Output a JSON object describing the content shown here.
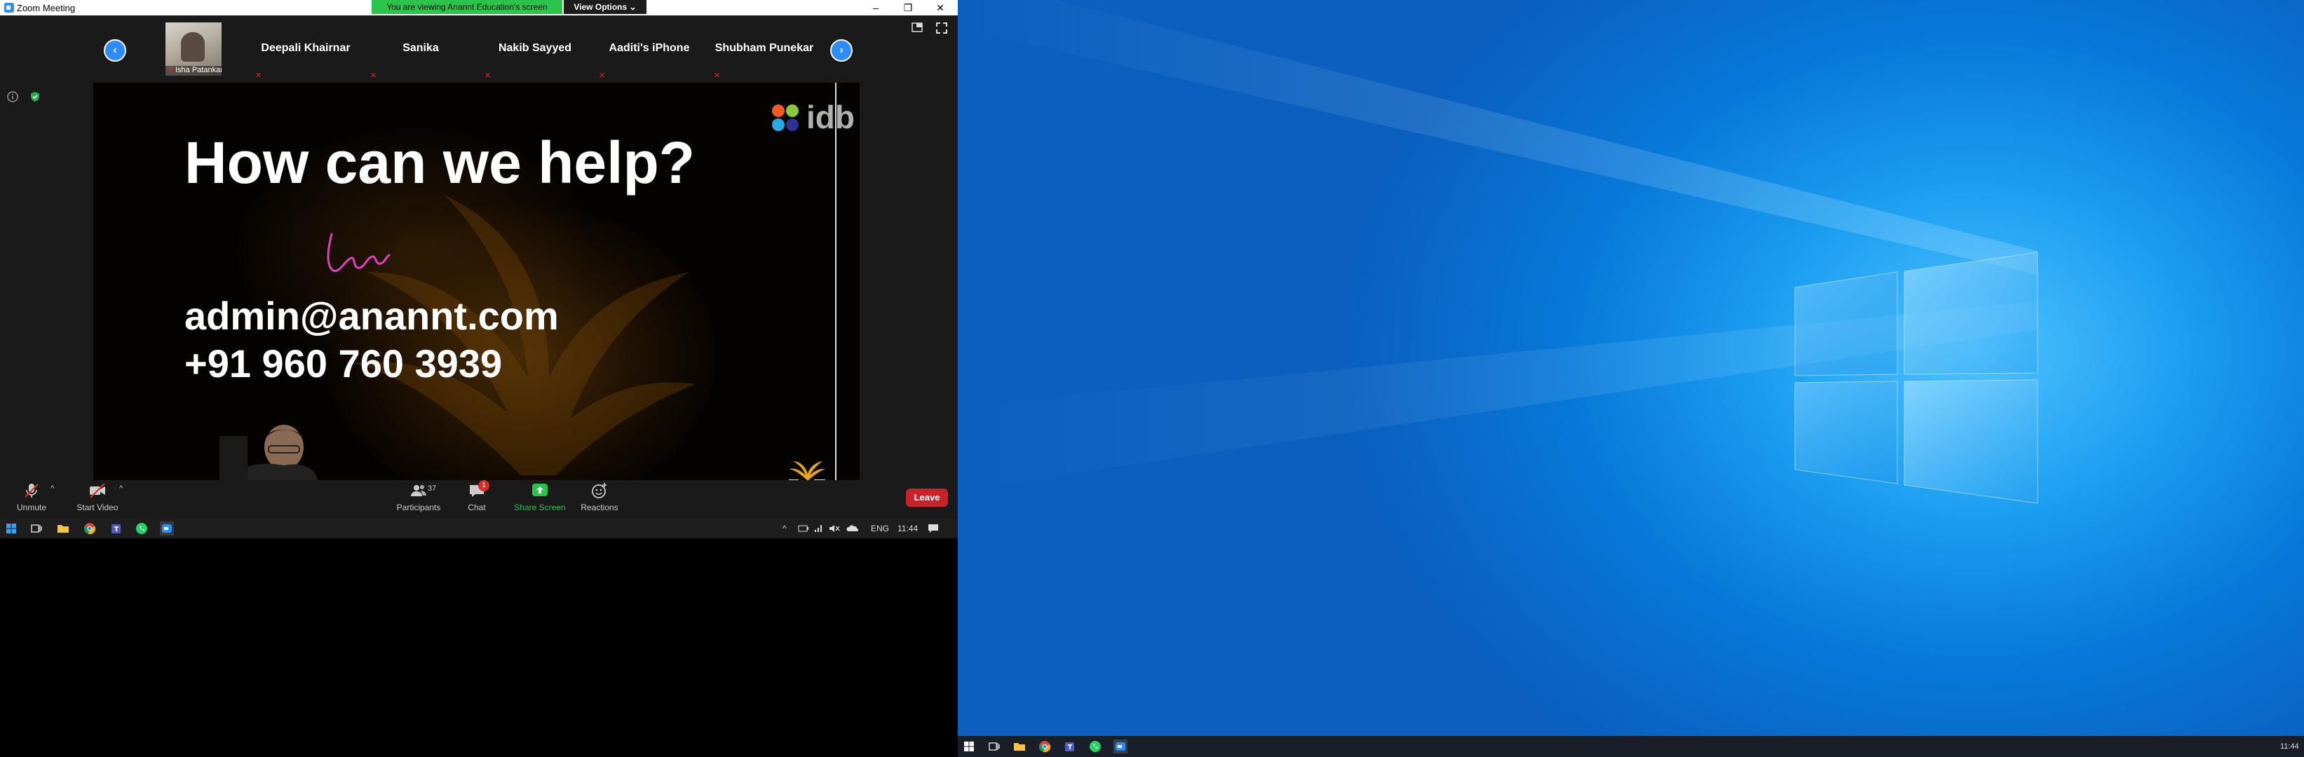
{
  "zoom": {
    "window_title": "Zoom Meeting",
    "share_banner": "You are viewing Anannt Education's screen",
    "view_options": "View Options",
    "window_controls": {
      "minimize": "–",
      "restore": "❐",
      "close": "✕"
    }
  },
  "participants": [
    {
      "name": "Isha Patankar",
      "has_video": true
    },
    {
      "name": "Deepali Khairnar",
      "has_video": false
    },
    {
      "name": "Sanika",
      "has_video": false
    },
    {
      "name": "Nakib Sayyed",
      "has_video": false
    },
    {
      "name": "Aaditi's iPhone",
      "has_video": false
    },
    {
      "name": "Shubham Punekar",
      "has_video": false
    }
  ],
  "slide": {
    "heading": "How can we help?",
    "email": "admin@anannt.com",
    "phone": "+91 960 760 3939",
    "logo_text": "idb",
    "annotation": "scribble"
  },
  "toolbar": {
    "unmute": "Unmute",
    "start_video": "Start Video",
    "participants": "Participants",
    "participants_count": "37",
    "chat": "Chat",
    "chat_badge": "1",
    "share_screen": "Share Screen",
    "reactions": "Reactions",
    "leave": "Leave"
  },
  "taskbar_left": {
    "language": "ENG",
    "time": "11:44",
    "icons": [
      "start-icon",
      "task-view-icon",
      "file-explorer-icon",
      "chrome-icon",
      "teams-icon",
      "whatsapp-icon",
      "zoom-icon"
    ]
  },
  "taskbar_right": {
    "time": "11:44",
    "icons": [
      "start-icon",
      "task-view-icon",
      "file-explorer-icon",
      "chrome-icon",
      "teams-icon",
      "whatsapp-icon",
      "zoom-icon"
    ]
  },
  "colors": {
    "zoom_blue": "#2d8cff",
    "share_green": "#2bc34a",
    "leave_red": "#c7242a",
    "desktop_blue": "#0878d8"
  }
}
